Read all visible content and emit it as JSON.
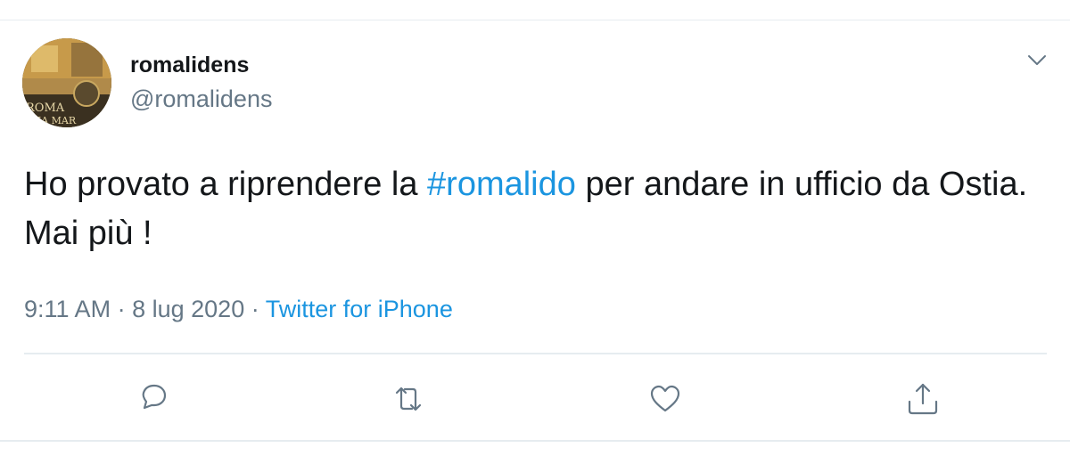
{
  "tweet": {
    "display_name": "romalidens",
    "handle": "@romalidens",
    "text_before": "Ho provato a riprendere la ",
    "hashtag": "#romalido",
    "text_after": " per andare in ufficio da Ostia. Mai più !",
    "time": "9:11 AM",
    "date": "8 lug 2020",
    "separator": "·",
    "source": "Twitter for iPhone"
  },
  "avatar_lettering": [
    "ROMA",
    "OSTIA MARE"
  ],
  "icons": {
    "caret": "chevron-down-icon",
    "reply": "reply-icon",
    "retweet": "retweet-icon",
    "like": "heart-icon",
    "share": "share-icon"
  },
  "colors": {
    "text": "#14171a",
    "secondary": "#657786",
    "link": "#1b95e0",
    "border": "#e6ecf0"
  }
}
